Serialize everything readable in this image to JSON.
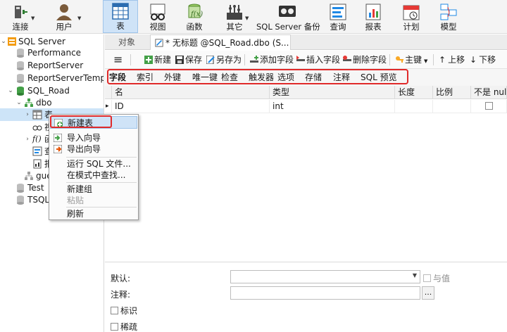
{
  "ribbon": {
    "items": [
      {
        "label": "连接",
        "icon": "connection-icon"
      },
      {
        "label": "用户",
        "icon": "user-icon"
      },
      {
        "label": "表",
        "icon": "table-icon"
      },
      {
        "label": "视图",
        "icon": "view-icon"
      },
      {
        "label": "函数",
        "icon": "function-icon"
      },
      {
        "label": "其它",
        "icon": "other-icon"
      },
      {
        "label": "SQL Server 备份",
        "icon": "backup-icon"
      },
      {
        "label": "查询",
        "icon": "query-icon"
      },
      {
        "label": "报表",
        "icon": "report-icon"
      },
      {
        "label": "计划",
        "icon": "schedule-icon"
      },
      {
        "label": "模型",
        "icon": "model-icon"
      }
    ],
    "active": "表"
  },
  "tree": {
    "nodes": [
      {
        "label": "SQL Server"
      },
      {
        "label": "Performance"
      },
      {
        "label": "ReportServer"
      },
      {
        "label": "ReportServerTempD"
      },
      {
        "label": "SQL_Road"
      },
      {
        "label": "dbo"
      },
      {
        "label": "表"
      },
      {
        "label": "视"
      },
      {
        "label": "函"
      },
      {
        "label": "查"
      },
      {
        "label": "报"
      },
      {
        "label": "gue"
      },
      {
        "label": "Test"
      },
      {
        "label": "TSQLF"
      }
    ]
  },
  "tabs": {
    "objects": "对象",
    "design": "* 无标题 @SQL_Road.dbo (S..."
  },
  "toolbar": {
    "menu_icon": "≡",
    "new": "新建",
    "save": "保存",
    "save_as": "另存为",
    "add_field": "添加字段",
    "insert_field": "插入字段",
    "delete_field": "删除字段",
    "primary_key": "主键",
    "move_up": "上移",
    "move_down": "下移"
  },
  "subtabs": [
    "字段",
    "索引",
    "外键",
    "唯一键",
    "检查",
    "触发器",
    "选项",
    "存储",
    "注释",
    "SQL 预览"
  ],
  "grid": {
    "headers": {
      "name": "名",
      "type": "类型",
      "length": "长度",
      "scale": "比例",
      "not_null": "不是 null"
    },
    "rows": [
      {
        "marker": "▸",
        "name": "ID",
        "type": "int",
        "length": "",
        "scale": "",
        "not_null": false
      }
    ]
  },
  "properties": {
    "default_label": "默认:",
    "default_value": "",
    "bind_label": "与值",
    "comment_label": "注释:",
    "comment_value": "",
    "browse_button": "...",
    "identity_label": "标识",
    "sparse_label": "稀疏"
  },
  "context_menu": {
    "items": [
      {
        "label": "新建表"
      },
      {
        "label": "导入向导"
      },
      {
        "label": "导出向导"
      },
      {
        "label": "运行 SQL 文件..."
      },
      {
        "label": "在模式中查找..."
      },
      {
        "label": "新建组"
      },
      {
        "label": "粘贴"
      },
      {
        "label": "刷新"
      }
    ]
  },
  "colors": {
    "highlight_red": "#e02a2a",
    "selection_blue": "#cfe3f7"
  }
}
